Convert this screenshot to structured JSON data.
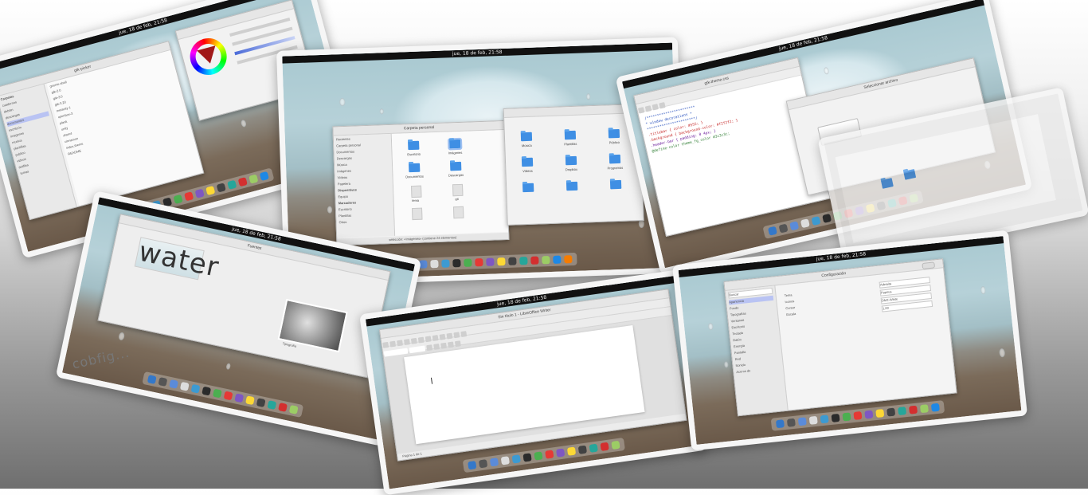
{
  "clock": "jue, 18 de feb, 21:58",
  "collage_caption": "cobfig...",
  "card_top_left": {
    "window_title": "gtk-picker",
    "sidebar_label": "Carpetas",
    "list_items": [
      "cuadernos",
      "debian",
      "descargas",
      "documentos",
      "escritorio",
      "imagenes",
      "musica",
      "plantillas",
      "publico",
      "videos",
      "dotfiles",
      "temas"
    ],
    "tree_items": [
      "gnome-shell",
      "gtk-2.0",
      "gtk-3.0",
      "gtk-3.20",
      "metacity-1",
      "openbox-3",
      "plank",
      "unity",
      "xfwm4",
      "cinnamon",
      "index.theme",
      "README"
    ]
  },
  "card_files": {
    "window_title": "Carpeta personal",
    "sidebar": [
      "Recientes",
      "Carpeta personal",
      "Documentos",
      "Descargas",
      "Música",
      "Imágenes",
      "Vídeos",
      "Papelera",
      "Dispositivos",
      "Equipo",
      "Marcadores",
      "Escritorio",
      "Plantillas",
      "Otros"
    ],
    "items": [
      "Escritorio",
      "Imágenes",
      "Documentos",
      "Descargas",
      "Música",
      "Plantillas",
      "Público",
      "Vídeos",
      "Dropbox",
      "Programas",
      "tema",
      "git"
    ],
    "status": "selección: «Imágenes» (contiene 24 elementos)"
  },
  "card_editor": {
    "window_title": "gtk-theme.css",
    "code_lines": [
      "/***********************",
      " * window decorations  *",
      " ***********************/",
      ".titlebar { color: #555; }",
      ".background { background-color: #f2f2f2; }",
      ".header-bar { padding: 0 4px; }",
      "@define-color theme_fg_color #3c3c3c;"
    ],
    "dialog_title": "Seleccionar archivo"
  },
  "card_typography": {
    "window_title": "Fuentes",
    "word": "water",
    "label": "Tipografía"
  },
  "card_writer": {
    "window_title": "Sin título 1 - LibreOffice Writer",
    "status": "Página 1 de 1"
  },
  "card_settings": {
    "window_title": "Configuración",
    "search": "Buscar",
    "sections": [
      "Apariencia",
      "Fondo",
      "Tipografías",
      "Ventanas",
      "Escritorio",
      "Teclado",
      "Ratón",
      "Energía",
      "Pantalla",
      "Red",
      "Sonido",
      "Acerca de"
    ],
    "labels": [
      "Tema",
      "Iconos",
      "Cursor",
      "Escala"
    ],
    "values": [
      "Adwaita",
      "Papirus",
      "DMZ-White",
      "1,00"
    ]
  },
  "colors": {
    "accent": "#3f8fe4",
    "topbar": "#111111",
    "frame": "#f6f6f6"
  }
}
